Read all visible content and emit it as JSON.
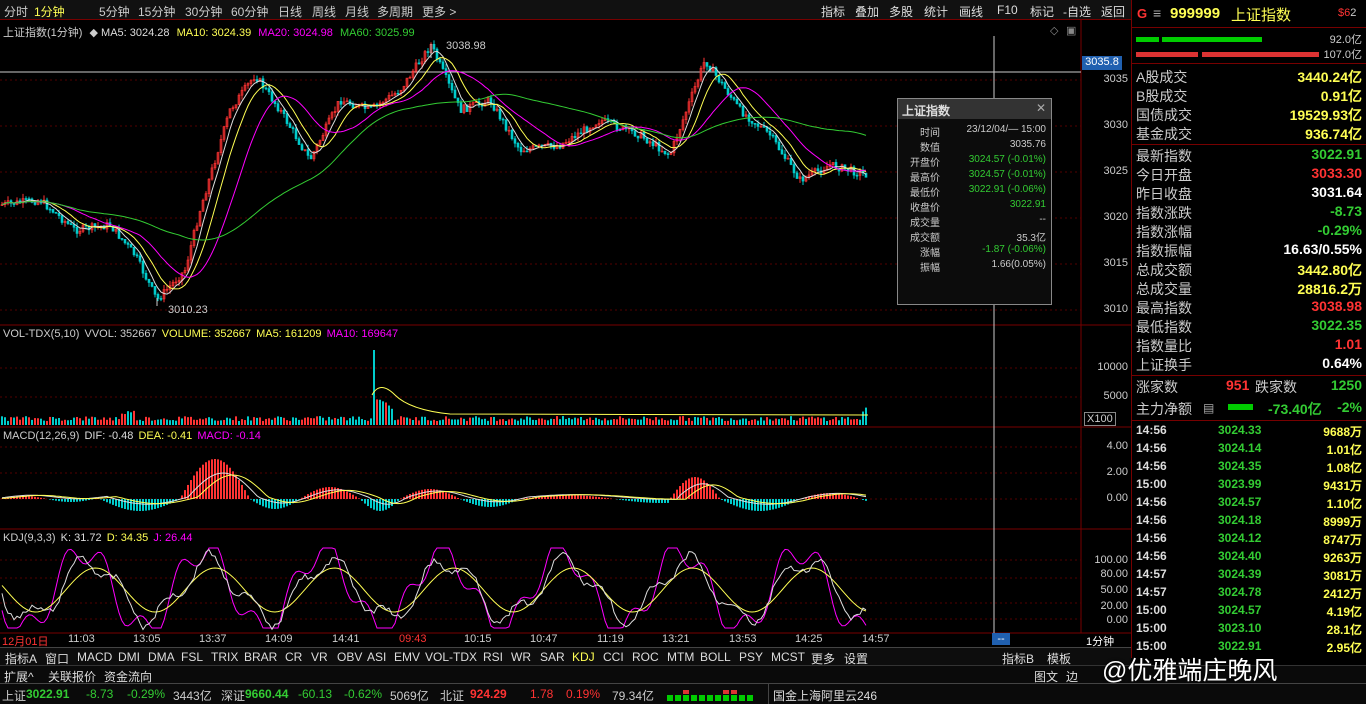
{
  "period_tabs": [
    "分时",
    "1分钟",
    "5分钟",
    "15分钟",
    "30分钟",
    "60分钟",
    "日线",
    "周线",
    "月线",
    "多周期",
    "更多 >"
  ],
  "active_period": "1分钟",
  "top_tools": [
    "指标",
    "叠加",
    "多股",
    "统计",
    "画线",
    "F10",
    "标记",
    "-自选",
    "返回"
  ],
  "main_legend": {
    "title": "上证指数(1分钟)",
    "ma5": "MA5: 3024.28",
    "ma10": "MA10: 3024.39",
    "ma20": "MA20: 3024.98",
    "ma60": "MA60: 3025.99"
  },
  "main_annotations": {
    "high": "3038.98",
    "low": "3010.23",
    "crosshair_price": "3035.8"
  },
  "price_axis": [
    "3035",
    "3030",
    "3025",
    "3020",
    "3015",
    "3010"
  ],
  "vol_legend": {
    "title": "VOL-TDX(5,10)",
    "vvol": "VVOL: 352667",
    "volume": "VOLUME: 352667",
    "ma5": "MA5: 161209",
    "ma10": "MA10: 169647"
  },
  "vol_axis": [
    "10000",
    "5000"
  ],
  "vol_unit": "X100",
  "macd_legend": {
    "title": "MACD(12,26,9)",
    "dif": "DIF: -0.48",
    "dea": "DEA: -0.41",
    "macd": "MACD: -0.14"
  },
  "macd_axis": [
    "4.00",
    "2.00",
    "0.00"
  ],
  "kdj_legend": {
    "title": "KDJ(9,3,3)",
    "k": "K: 31.72",
    "d": "D: 34.35",
    "j": "J: 26.44"
  },
  "kdj_axis": [
    "100.00",
    "80.00",
    "50.00",
    "20.00",
    "0.00"
  ],
  "time_axis": [
    "12月01日",
    "11:03",
    "13:05",
    "13:37",
    "14:09",
    "14:41",
    "09:43",
    "10:15",
    "10:47",
    "11:19",
    "13:21",
    "13:53",
    "14:25",
    "14:57"
  ],
  "time_axis_period": "1分钟",
  "time_cursor": "--",
  "popup": {
    "title": "上证指数",
    "rows": [
      {
        "k": "时间",
        "v": "23/12/04/— 15:00",
        "c": "#ccc"
      },
      {
        "k": "数值",
        "v": "3035.76",
        "c": "#ccc"
      },
      {
        "k": "开盘价",
        "v": "3024.57 (-0.01%)",
        "c": "#3c3"
      },
      {
        "k": "最高价",
        "v": "3024.57 (-0.01%)",
        "c": "#3c3"
      },
      {
        "k": "最低价",
        "v": "3022.91 (-0.06%)",
        "c": "#3c3"
      },
      {
        "k": "收盘价",
        "v": "3022.91",
        "c": "#3c3"
      },
      {
        "k": "成交量",
        "v": "--",
        "c": "#ccc"
      },
      {
        "k": "成交额",
        "v": "35.3亿",
        "c": "#ccc"
      },
      {
        "k": "涨幅",
        "v": "-1.87 (-0.06%)",
        "c": "#3c3"
      },
      {
        "k": "振幅",
        "v": "1.66(0.05%)",
        "c": "#ccc"
      }
    ]
  },
  "right_header": {
    "g": "G",
    "menu": "≡",
    "code": "999999",
    "name": "上证指数",
    "badge": "$6",
    "badge_sub": "2"
  },
  "right_bars": {
    "top_value": "92.0亿",
    "bottom_value": "107.0亿"
  },
  "stats": [
    {
      "k": "A股成交",
      "v": "3440.24亿",
      "c": "#ffff54"
    },
    {
      "k": "B股成交",
      "v": "0.91亿",
      "c": "#ffff54"
    },
    {
      "k": "国债成交",
      "v": "19529.93亿",
      "c": "#ffff54"
    },
    {
      "k": "基金成交",
      "v": "936.74亿",
      "c": "#ffff54"
    },
    {
      "k": "最新指数",
      "v": "3022.91",
      "c": "#3c3"
    },
    {
      "k": "今日开盘",
      "v": "3033.30",
      "c": "#f33"
    },
    {
      "k": "昨日收盘",
      "v": "3031.64",
      "c": "#fff"
    },
    {
      "k": "指数涨跌",
      "v": "-8.73",
      "c": "#3c3"
    },
    {
      "k": "指数涨幅",
      "v": "-0.29%",
      "c": "#3c3"
    },
    {
      "k": "指数振幅",
      "v": "16.63/0.55%",
      "c": "#fff"
    },
    {
      "k": "总成交额",
      "v": "3442.80亿",
      "c": "#ffff54"
    },
    {
      "k": "总成交量",
      "v": "28816.2万",
      "c": "#ffff54"
    },
    {
      "k": "最高指数",
      "v": "3038.98",
      "c": "#f33"
    },
    {
      "k": "最低指数",
      "v": "3022.35",
      "c": "#3c3"
    },
    {
      "k": "指数量比",
      "v": "1.01",
      "c": "#f33"
    },
    {
      "k": "上证换手",
      "v": "0.64%",
      "c": "#fff"
    }
  ],
  "breadth": {
    "up_label": "涨家数",
    "up": "951",
    "down_label": "跌家数",
    "down": "1250"
  },
  "main_flow": {
    "label": "主力净额",
    "value": "-73.40亿",
    "pct": "-2%"
  },
  "ticks": [
    {
      "t": "14:56",
      "p": "3024.33",
      "v": "9688万"
    },
    {
      "t": "14:56",
      "p": "3024.14",
      "v": "1.01亿"
    },
    {
      "t": "14:56",
      "p": "3024.35",
      "v": "1.08亿"
    },
    {
      "t": "15:00",
      "p": "3023.99",
      "v": "9431万"
    },
    {
      "t": "14:56",
      "p": "3024.57",
      "v": "1.10亿"
    },
    {
      "t": "14:56",
      "p": "3024.18",
      "v": "8999万"
    },
    {
      "t": "14:56",
      "p": "3024.12",
      "v": "8747万"
    },
    {
      "t": "14:56",
      "p": "3024.40",
      "v": "9263万"
    },
    {
      "t": "14:57",
      "p": "3024.39",
      "v": "3081万"
    },
    {
      "t": "14:57",
      "p": "3024.78",
      "v": "2412万"
    },
    {
      "t": "15:00",
      "p": "3024.57",
      "v": "4.19亿"
    },
    {
      "t": "15:00",
      "p": "3023.10",
      "v": "28.1亿"
    },
    {
      "t": "15:00",
      "p": "3022.91",
      "v": "2.95亿"
    }
  ],
  "indicator_tabs": [
    "指标A",
    "窗口",
    "MACD",
    "DMI",
    "DMA",
    "FSL",
    "TRIX",
    "BRAR",
    "CR",
    "VR",
    "OBV",
    "ASI",
    "EMV",
    "VOL-TDX",
    "RSI",
    "WR",
    "SAR",
    "KDJ",
    "CCI",
    "ROC",
    "MTM",
    "BOLL",
    "PSY",
    "MCST",
    "更多",
    "设置"
  ],
  "indicator_b": "指标B",
  "mode_b": "模板",
  "bottom_left_tabs": [
    "扩展^",
    "关联报价",
    "资金流向"
  ],
  "bottom_right_tabs": [
    "图文",
    "边"
  ],
  "watermark": "@优雅端庄晚风",
  "status": {
    "sh_label": "上证",
    "sh_val": "3022.91",
    "sh_chg": "-8.73",
    "sh_pct": "-0.29%",
    "sh_amt": "3443亿",
    "sz_label": "深证",
    "sz_val": "9660.44",
    "sz_chg": "-60.13",
    "sz_pct": "-0.62%",
    "sz_amt": "5069亿",
    "bz_label": "北证",
    "bz_val": "924.29",
    "bz_chg": "1.78",
    "bz_pct": "0.19%",
    "bz_amt": "79.34亿",
    "server": "国金上海阿里云246"
  }
}
